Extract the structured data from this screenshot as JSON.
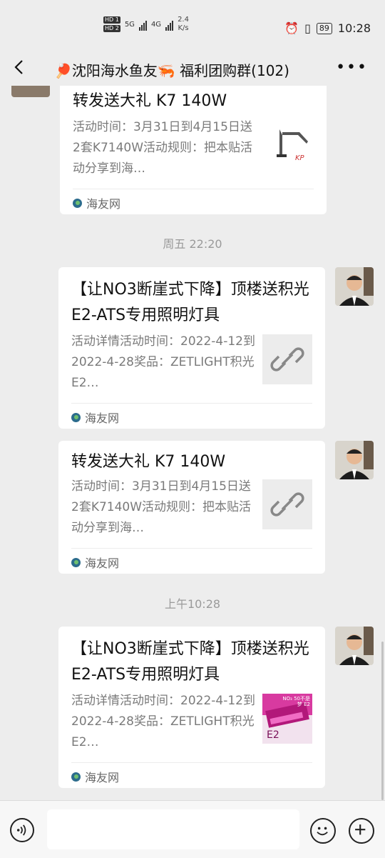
{
  "status": {
    "hd_top": "HD 1",
    "hd_bottom": "HD 2",
    "net1": "5G",
    "net2": "4G",
    "speed_value": "2.4",
    "speed_unit": "K/s",
    "battery": "89",
    "clock": "10:28"
  },
  "chat": {
    "title": "🏓沈阳海水鱼友🦐  福利团购群(102)"
  },
  "messages": [
    {
      "title": "转发送大礼 K7 140W",
      "desc": "活动时间：3月31日到4月15日送2套K7140W活动规则：把本贴活动分享到海…",
      "source": "海友网"
    },
    {
      "time": "周五 22:20"
    },
    {
      "title": "【让NO3断崖式下降】顶楼送积光E2-ATS专用照明灯具",
      "desc": "活动详情活动时间：2022-4-12到2022-4-28奖品：ZETLIGHT积光E2…",
      "source": "海友网"
    },
    {
      "title": "转发送大礼 K7 140W",
      "desc": "活动时间：3月31日到4月15日送2套K7140W活动规则：把本贴活动分享到海…",
      "source": "海友网"
    },
    {
      "time": "上午10:28"
    },
    {
      "title": "【让NO3断崖式下降】顶楼送积光E2-ATS专用照明灯具",
      "desc": "活动详情活动时间：2022-4-12到2022-4-28奖品：ZETLIGHT积光E2…",
      "source": "海友网",
      "thumb_text": "NO₃ 50不是梦 E2"
    }
  ],
  "colors": {
    "background": "#ededed",
    "card": "#ffffff",
    "muted_text": "#7a7a7a",
    "timestamp": "#9a9a9a"
  },
  "icons": [
    "back-arrow-icon",
    "more-dots-icon",
    "voice-icon",
    "emoji-icon",
    "plus-icon",
    "link-icon",
    "haiyou-logo-icon"
  ]
}
